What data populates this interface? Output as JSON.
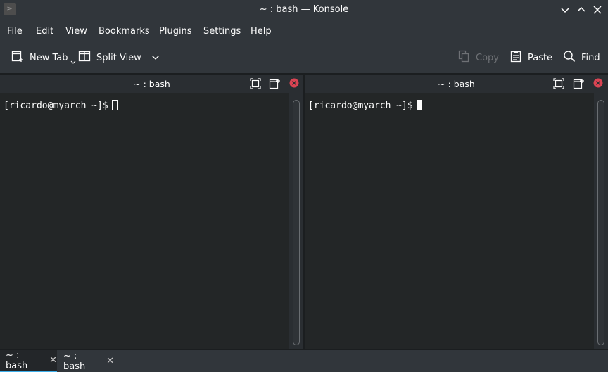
{
  "window": {
    "title": "~ : bash — Konsole",
    "app_icon_glyph": "≥"
  },
  "menubar": {
    "items": [
      "File",
      "Edit",
      "View",
      "Bookmarks",
      "Plugins",
      "Settings",
      "Help"
    ]
  },
  "toolbar": {
    "new_tab_label": "New Tab",
    "split_view_label": "Split View",
    "copy_label": "Copy",
    "paste_label": "Paste",
    "find_label": "Find"
  },
  "panes": [
    {
      "title": "~ : bash",
      "prompt": "[ricardo@myarch ~]$",
      "cursor": "hollow"
    },
    {
      "title": "~ : bash",
      "prompt": "[ricardo@myarch ~]$",
      "cursor": "solid"
    }
  ],
  "tabs": [
    {
      "label": "~ : bash",
      "active": true,
      "close_glyph": "✕"
    },
    {
      "label": "~ : bash",
      "active": false,
      "close_glyph": "✕"
    }
  ],
  "colors": {
    "accent": "#3daee9",
    "close_red": "#da4453",
    "terminal_bg": "#232627",
    "chrome_bg": "#31363b"
  },
  "icons": {
    "window": [
      "minimize-icon",
      "maximize-icon",
      "close-icon"
    ],
    "toolbar": [
      "new-tab-icon",
      "split-view-icon",
      "chevron-down-icon",
      "copy-icon",
      "paste-icon",
      "find-icon"
    ],
    "pane": [
      "maximize-pane-icon",
      "detach-pane-icon",
      "close-pane-icon"
    ]
  }
}
